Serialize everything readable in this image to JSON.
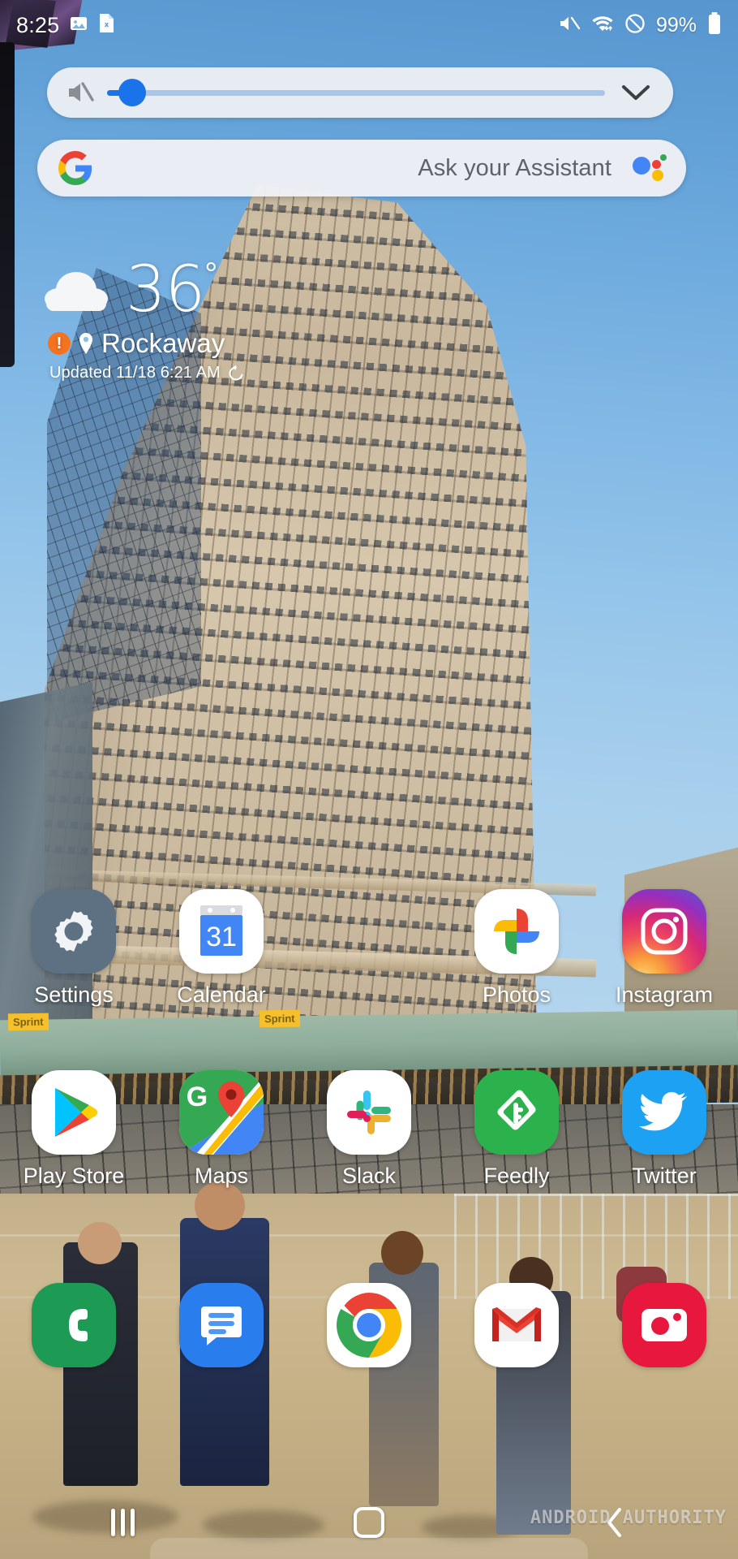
{
  "status_bar": {
    "time": "8:25",
    "battery_percent": "99%",
    "left_icons": [
      "image-icon",
      "xls-file-icon"
    ],
    "right_icons": [
      "mute-icon",
      "wifi-icon",
      "do-not-disturb-icon",
      "battery-icon"
    ]
  },
  "volume_panel": {
    "mute_icon": "volume-muted-icon",
    "value": 3,
    "max": 100,
    "expand_icon": "chevron-down-icon",
    "track_color": "#a9c6ea",
    "thumb_color": "#1a73e8"
  },
  "search_bar": {
    "logo": "google-g-logo",
    "placeholder": "Ask your Assistant",
    "assistant_icon": "google-assistant-icon"
  },
  "weather": {
    "condition_icon": "cloud-icon",
    "temperature": "36",
    "degree_symbol": "°",
    "alert_icon": "weather-alert-icon",
    "location_icon": "location-pin-icon",
    "location": "Rockaway",
    "updated": "Updated 11/18 6:21 AM",
    "refresh_icon": "refresh-icon",
    "alert_color": "#f4731f"
  },
  "app_rows": [
    {
      "apps": [
        {
          "label": "Settings",
          "icon": "settings-gear-icon"
        },
        {
          "label": "Calendar",
          "icon": "calendar-icon",
          "badge": "31"
        },
        {
          "label": "",
          "icon": "",
          "empty": true
        },
        {
          "label": "Photos",
          "icon": "google-photos-icon"
        },
        {
          "label": "Instagram",
          "icon": "instagram-icon"
        }
      ]
    },
    {
      "apps": [
        {
          "label": "Play Store",
          "icon": "google-play-icon"
        },
        {
          "label": "Maps",
          "icon": "google-maps-icon"
        },
        {
          "label": "Slack",
          "icon": "slack-icon"
        },
        {
          "label": "Feedly",
          "icon": "feedly-icon"
        },
        {
          "label": "Twitter",
          "icon": "twitter-bird-icon"
        }
      ]
    }
  ],
  "dock": {
    "apps": [
      {
        "label": "",
        "icon": "phone-icon"
      },
      {
        "label": "",
        "icon": "messages-icon"
      },
      {
        "label": "",
        "icon": "chrome-icon"
      },
      {
        "label": "",
        "icon": "gmail-icon"
      },
      {
        "label": "",
        "icon": "camera-icon"
      }
    ]
  },
  "nav_bar": {
    "recents_icon": "recents-icon",
    "home_icon": "home-icon",
    "back_icon": "back-chevron-icon"
  },
  "watermark": "ANDROID AUTHORITY",
  "wallpaper": {
    "description": "Flatiron Building under blue sky",
    "sky_color": "#7bb4e3",
    "sprint_signs": [
      "Sprint",
      "Sprint"
    ]
  }
}
